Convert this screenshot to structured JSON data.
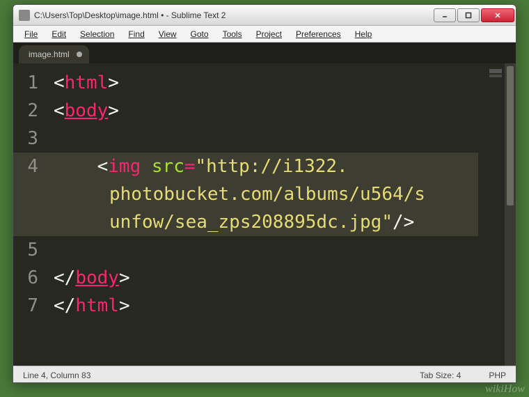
{
  "titlebar": {
    "text": "C:\\Users\\Top\\Desktop\\image.html • - Sublime Text 2"
  },
  "menu": {
    "file": "File",
    "edit": "Edit",
    "selection": "Selection",
    "find": "Find",
    "view": "View",
    "goto": "Goto",
    "tools": "Tools",
    "project": "Project",
    "preferences": "Preferences",
    "help": "Help"
  },
  "tab": {
    "label": "image.html"
  },
  "gutter": {
    "l1": "1",
    "l2": "2",
    "l3": "3",
    "l4": "4",
    "l5": "5",
    "l6": "6",
    "l7": "7"
  },
  "code": {
    "l1_open": "<",
    "l1_tag": "html",
    "l1_close": ">",
    "l2_open": "<",
    "l2_tag": "body",
    "l2_close": ">",
    "l4_indent": "    ",
    "l4_open": "<",
    "l4_tag": "img",
    "l4_sp": " ",
    "l4_attr": "src",
    "l4_eq": "=",
    "l4_str1": "\"http://i1322.",
    "l4_str2": "photobucket.com/albums/u564/s",
    "l4_str3": "unfow/sea_zps208895dc.jpg\"",
    "l4_selfclose": "/>",
    "l6_open": "</",
    "l6_tag": "body",
    "l6_close": ">",
    "l7_open": "</",
    "l7_tag": "html",
    "l7_close": ">"
  },
  "status": {
    "left": "Line 4, Column 83",
    "tabsize": "Tab Size: 4",
    "syntax": "PHP"
  },
  "watermark": "wikiHow"
}
